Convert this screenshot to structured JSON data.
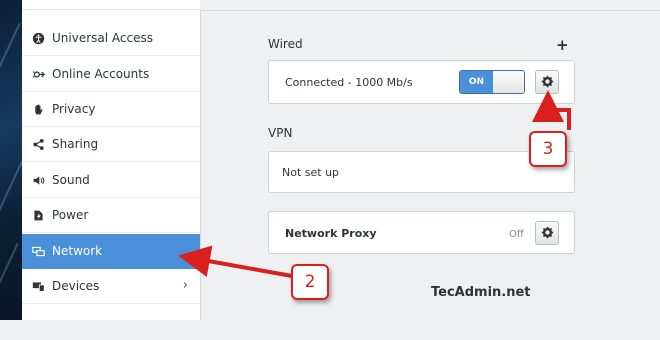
{
  "sidebar": {
    "items": [
      {
        "label": "Universal Access",
        "icon": "universal-access-icon"
      },
      {
        "label": "Online Accounts",
        "icon": "online-accounts-icon"
      },
      {
        "label": "Privacy",
        "icon": "hand-icon"
      },
      {
        "label": "Sharing",
        "icon": "share-icon"
      },
      {
        "label": "Sound",
        "icon": "speaker-icon"
      },
      {
        "label": "Power",
        "icon": "power-icon"
      },
      {
        "label": "Network",
        "icon": "network-icon",
        "active": true
      },
      {
        "label": "Devices",
        "icon": "devices-icon",
        "chevron": "›"
      }
    ]
  },
  "wired": {
    "title": "Wired",
    "add_label": "+",
    "status": "Connected - 1000 Mb/s",
    "toggle_on_label": "ON"
  },
  "vpn": {
    "title": "VPN",
    "status": "Not set up"
  },
  "proxy": {
    "label": "Network Proxy",
    "value": "Off"
  },
  "annotations": {
    "badge_network": "2",
    "badge_settings": "3",
    "watermark": "TecAdmin.net"
  },
  "colors": {
    "accent": "#4a90d9",
    "annotation_red": "#d9201e"
  }
}
